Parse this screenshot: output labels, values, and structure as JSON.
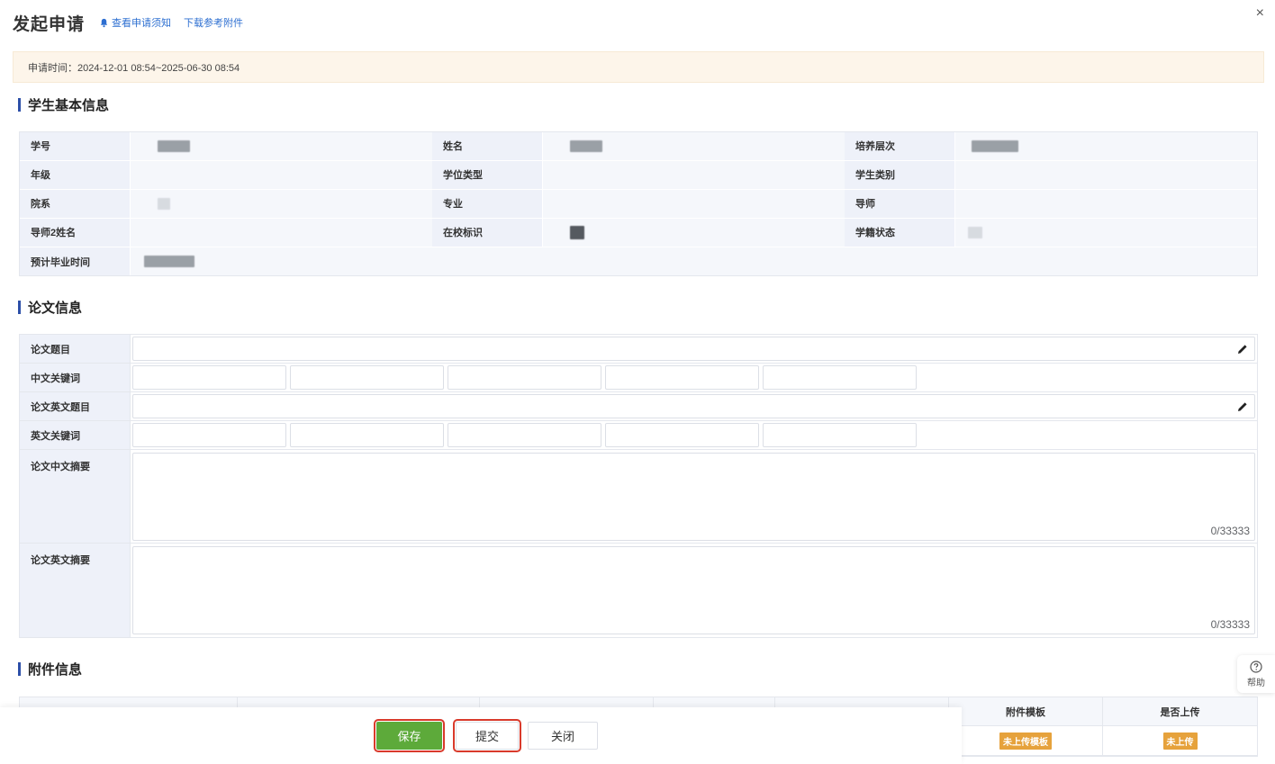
{
  "header": {
    "title": "发起申请",
    "notice_link": "查看申请须知",
    "download_link": "下载参考附件",
    "close_symbol": "×"
  },
  "notice": {
    "text": "申请时间：2024-12-01 08:54~2025-06-30 08:54"
  },
  "basic_info": {
    "section_title": "学生基本信息",
    "labels": {
      "student_id": "学号",
      "name": "姓名",
      "level": "培养层次",
      "grade": "年级",
      "degree_type": "学位类型",
      "student_type": "学生类别",
      "department": "院系",
      "major": "专业",
      "advisor": "导师",
      "advisor2": "导师2姓名",
      "on_campus": "在校标识",
      "status": "学籍状态",
      "grad_time": "预计毕业时间"
    }
  },
  "thesis": {
    "section_title": "论文信息",
    "labels": {
      "title_cn": "论文题目",
      "keywords_cn": "中文关键词",
      "title_en": "论文英文题目",
      "keywords_en": "英文关键词",
      "abstract_cn": "论文中文摘要",
      "abstract_en": "论文英文摘要"
    },
    "abstract_cn_counter": "0/33333",
    "abstract_en_counter": "0/33333"
  },
  "attachments": {
    "section_title": "附件信息",
    "columns_visible": [
      "附件模板",
      "是否上传"
    ],
    "row1": {
      "template_tag": "未上传模板",
      "uploaded_tag": "未上传"
    }
  },
  "footer": {
    "save": "保存",
    "submit": "提交",
    "close": "关闭"
  },
  "help": {
    "label": "帮助"
  },
  "colors": {
    "accent": "#2d4fa8",
    "link": "#2d6fd1",
    "save": "#5daa3a",
    "warning_tag": "#e6a23c",
    "highlight": "#d93a2b"
  }
}
